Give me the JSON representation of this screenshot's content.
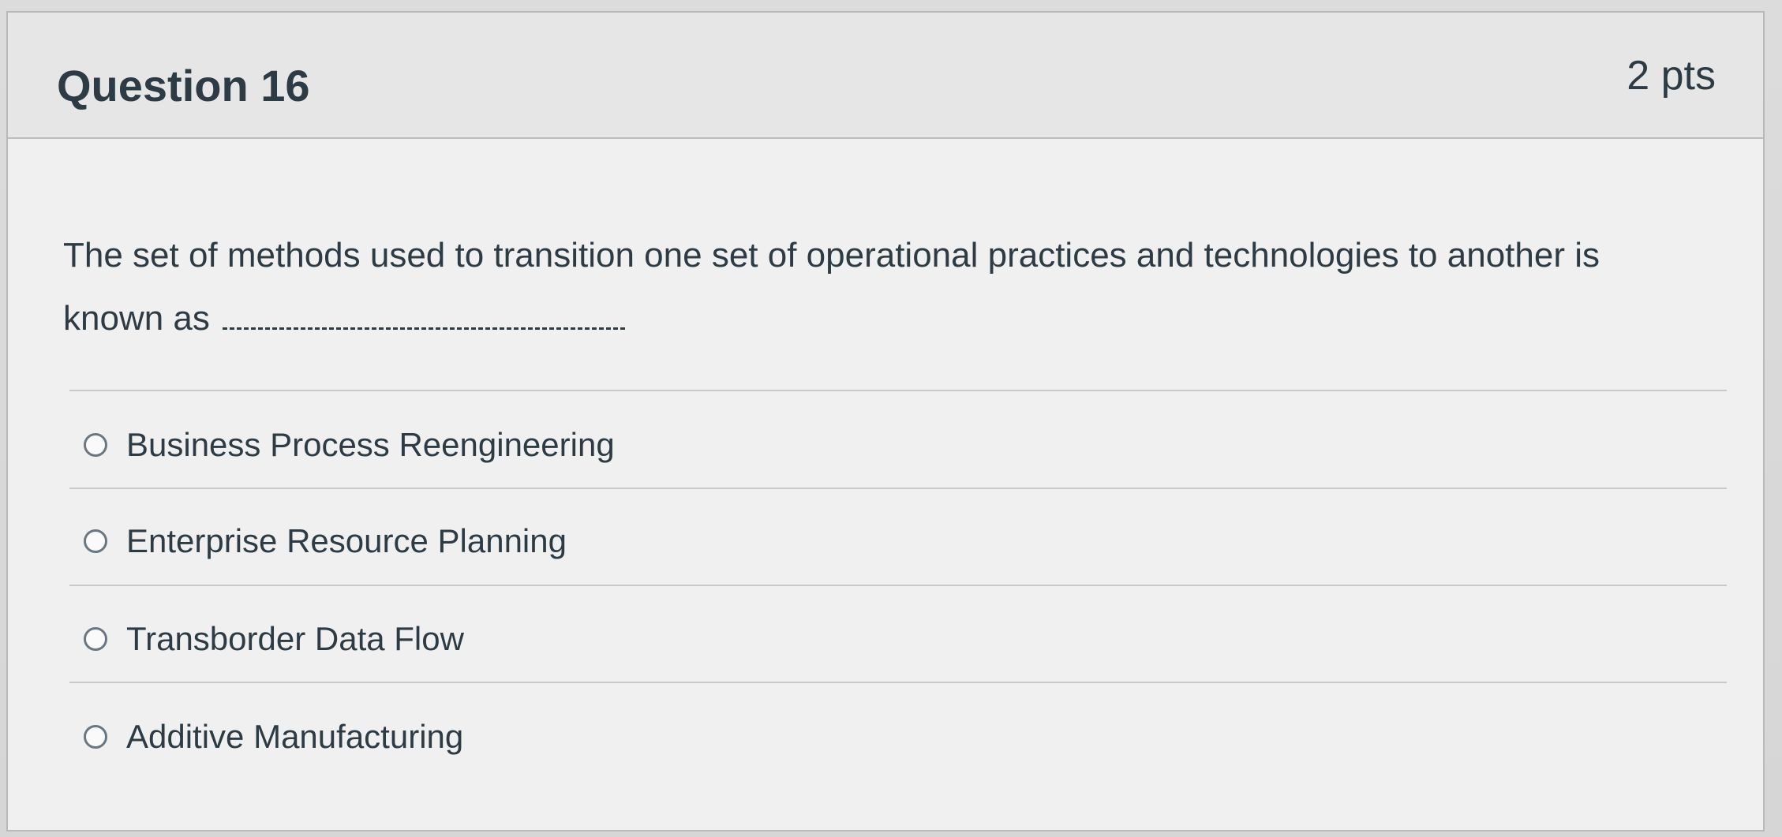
{
  "question": {
    "title": "Question 16",
    "points": "2 pts",
    "text": "The set of methods used to transition one set of operational practices and technologies to another is known as"
  },
  "answers": [
    {
      "label": "Business Process Reengineering",
      "selected": false
    },
    {
      "label": "Enterprise Resource Planning",
      "selected": false
    },
    {
      "label": "Transborder Data Flow",
      "selected": false
    },
    {
      "label": "Additive Manufacturing",
      "selected": false
    }
  ]
}
